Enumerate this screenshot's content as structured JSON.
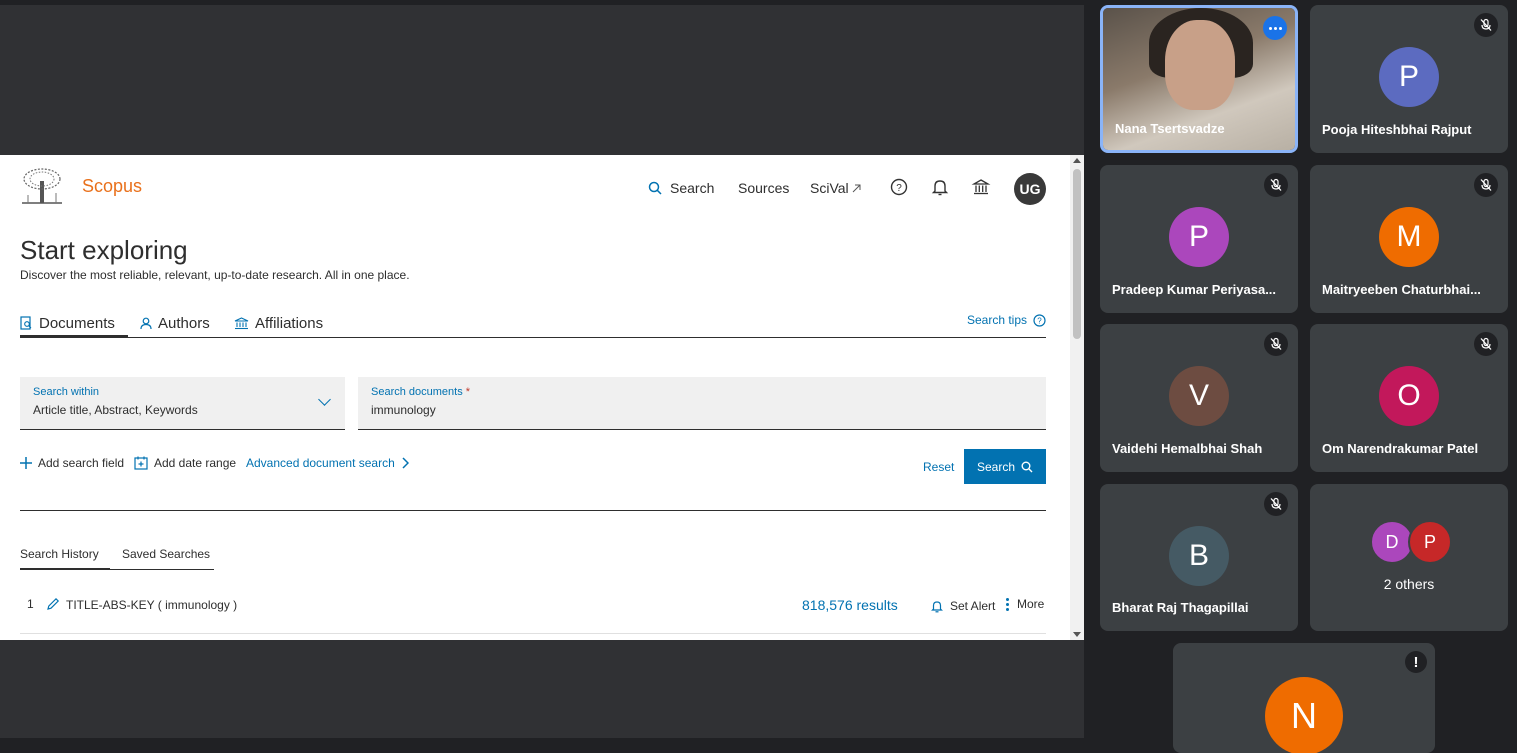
{
  "scopus": {
    "brand": "Scopus",
    "nav": {
      "search": "Search",
      "sources": "Sources",
      "scival": "SciVal"
    },
    "user_initials": "UG",
    "title": "Start exploring",
    "subtitle": "Discover the most reliable, relevant, up-to-date research. All in one place.",
    "tabs": [
      {
        "label": "Documents",
        "active": true
      },
      {
        "label": "Authors",
        "active": false
      },
      {
        "label": "Affiliations",
        "active": false
      }
    ],
    "search_tips": "Search tips",
    "search_within": {
      "label": "Search within",
      "value": "Article title, Abstract, Keywords"
    },
    "search_documents": {
      "label": "Search documents",
      "required_mark": "*",
      "value": "immunology"
    },
    "actions": {
      "add_field": "Add search field",
      "add_date": "Add date range",
      "advanced": "Advanced document search",
      "reset": "Reset",
      "search": "Search"
    },
    "history_tabs": [
      "Search History",
      "Saved Searches"
    ],
    "history": [
      {
        "num": "1",
        "query": "TITLE-ABS-KEY ( immunology )",
        "results": "818,576 results",
        "alert": "Set Alert",
        "more": "More"
      }
    ]
  },
  "participants": [
    {
      "name": "Nana Tsertsvadze",
      "video": true
    },
    {
      "name": "Pooja Hiteshbhai Rajput",
      "initial": "P",
      "color": "#5c6bc0",
      "muted": true
    },
    {
      "name": "Pradeep Kumar Periyasa...",
      "initial": "P",
      "color": "#ab47bc",
      "muted": true
    },
    {
      "name": "Maitryeeben Chaturbhai...",
      "initial": "M",
      "color": "#ef6c00",
      "muted": true
    },
    {
      "name": "Vaidehi Hemalbhai Shah",
      "initial": "V",
      "color": "#6d4c41",
      "muted": true
    },
    {
      "name": "Om Narendrakumar Patel",
      "initial": "O",
      "color": "#c2185b",
      "muted": true
    },
    {
      "name": "Bharat Raj Thagapillai",
      "initial": "B",
      "color": "#455a64",
      "muted": true
    }
  ],
  "others": {
    "label": "2 others",
    "initials": [
      "D",
      "P"
    ],
    "colors": [
      "#ab47bc",
      "#c62828"
    ]
  },
  "presenter_tile": {
    "initial": "N",
    "color": "#ef6c00",
    "warning": "!"
  }
}
